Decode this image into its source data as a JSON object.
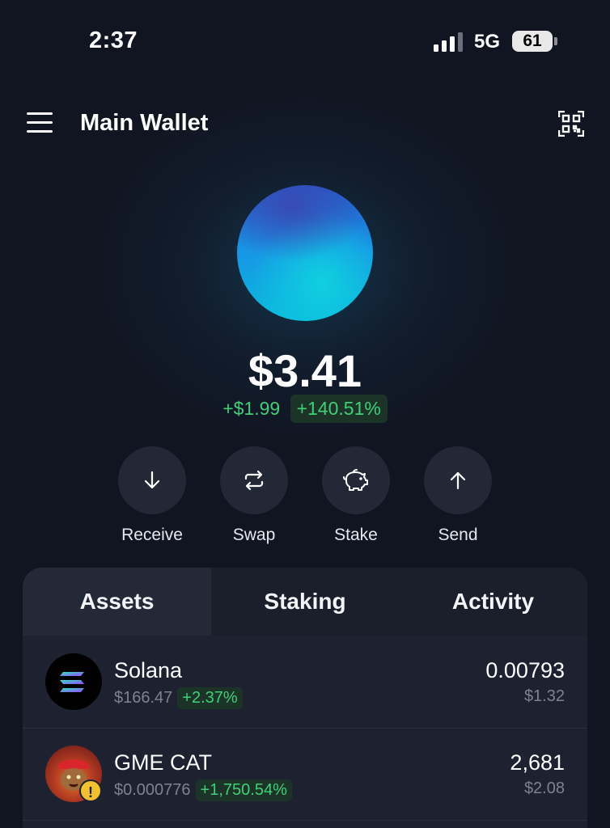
{
  "status_bar": {
    "time": "2:37",
    "network": "5G",
    "battery": "61"
  },
  "header": {
    "title": "Main Wallet"
  },
  "balance": {
    "total": "$3.41",
    "change_abs": "+$1.99",
    "change_pct": "+140.51%"
  },
  "actions": [
    {
      "label": "Receive",
      "icon": "arrow-down-icon"
    },
    {
      "label": "Swap",
      "icon": "swap-icon"
    },
    {
      "label": "Stake",
      "icon": "piggy-bank-icon"
    },
    {
      "label": "Send",
      "icon": "arrow-up-icon"
    }
  ],
  "tabs": [
    {
      "label": "Assets",
      "active": true
    },
    {
      "label": "Staking",
      "active": false
    },
    {
      "label": "Activity",
      "active": false
    }
  ],
  "assets": [
    {
      "name": "Solana",
      "price": "$166.47",
      "change": "+2.37%",
      "amount": "0.00793",
      "value": "$1.32",
      "icon": "solana-logo-icon"
    },
    {
      "name": "GME CAT",
      "price": "$0.000776",
      "change": "+1,750.54%",
      "amount": "2,681",
      "value": "$2.08",
      "icon": "gme-cat-avatar-icon",
      "badge": "!"
    }
  ],
  "colors": {
    "background": "#111521",
    "positive": "#3fd077",
    "panel": "#1d2130",
    "warning": "#f2c12e"
  }
}
